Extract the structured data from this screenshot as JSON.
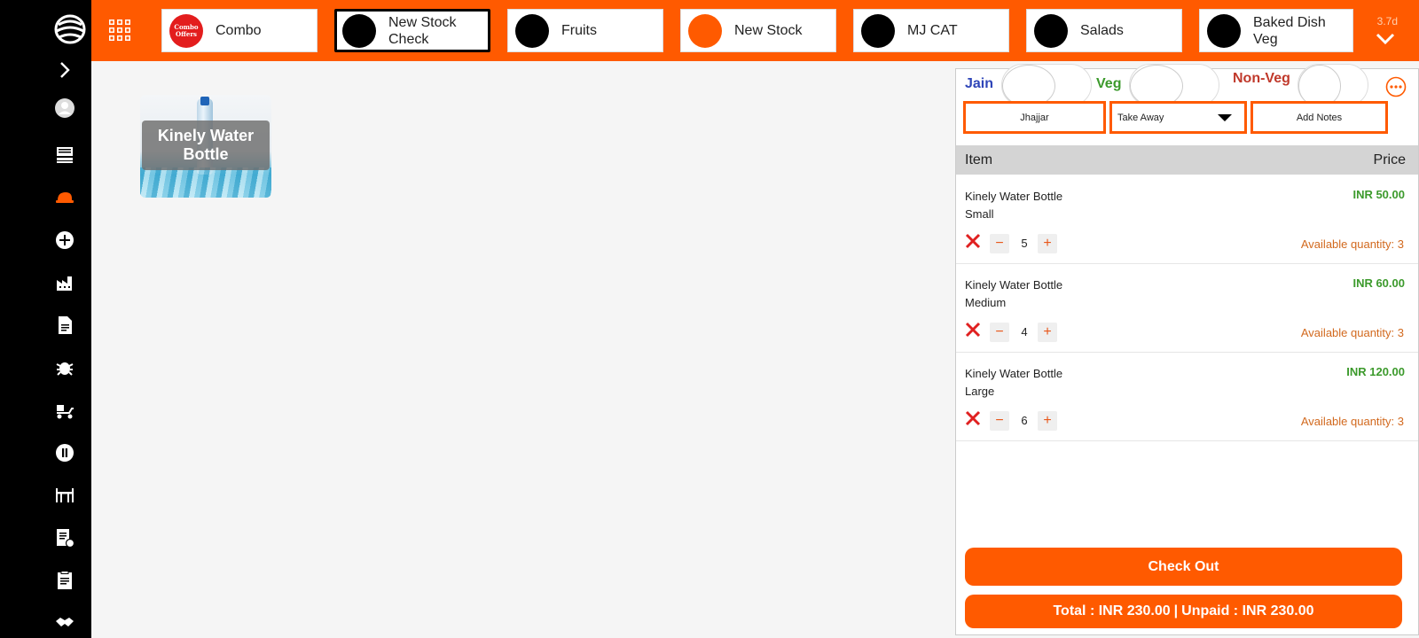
{
  "sidebar": {
    "items": [
      {
        "name": "expand-icon"
      },
      {
        "name": "profile-icon"
      },
      {
        "name": "pos-terminal-icon"
      },
      {
        "name": "delivery-hat-icon",
        "active_color": "#ff5a00"
      },
      {
        "name": "add-circle-icon"
      },
      {
        "name": "factory-icon"
      },
      {
        "name": "document-icon"
      },
      {
        "name": "bug-icon"
      },
      {
        "name": "delivery-scooter-icon"
      },
      {
        "name": "pause-icon"
      },
      {
        "name": "dining-table-icon"
      },
      {
        "name": "report-settings-icon"
      },
      {
        "name": "clipboard-icon"
      },
      {
        "name": "handshake-icon"
      }
    ]
  },
  "topbar": {
    "accent": "#ff5a00",
    "categories": [
      {
        "label": "Combo",
        "badge": "Combo Offers"
      },
      {
        "label": "New Stock Check"
      },
      {
        "label": "Fruits"
      },
      {
        "label": "New Stock"
      },
      {
        "label": "MJ CAT"
      },
      {
        "label": "Salads"
      },
      {
        "label": "Baked Dish Veg"
      }
    ],
    "size_label": "3.7d"
  },
  "products": [
    {
      "name": "Kinely Water Bottle",
      "bottle_brand": "kinley"
    }
  ],
  "order_panel": {
    "diet": {
      "jain": "Jain",
      "veg": "Veg",
      "nonveg": "Non-Veg"
    },
    "location": "Jhajjar",
    "mode": "Take Away",
    "notes_label": "Add Notes",
    "header": {
      "item": "Item",
      "price": "Price"
    },
    "items": [
      {
        "name": "Kinely Water Bottle",
        "variant": "Small",
        "price": "INR  50.00",
        "qty": "5",
        "available": "Available quantity: 3"
      },
      {
        "name": "Kinely Water Bottle",
        "variant": "Medium",
        "price": "INR  60.00",
        "qty": "4",
        "available": "Available quantity: 3"
      },
      {
        "name": "Kinely Water Bottle",
        "variant": "Large",
        "price": "INR  120.00",
        "qty": "6",
        "available": "Available quantity: 3"
      }
    ],
    "minus_symbol": "−",
    "plus_symbol": "+",
    "checkout_label": "Check Out",
    "total_label": "Total : INR  230.00",
    "unpaid_label": "Unpaid : INR  230.00",
    "separator": "|"
  }
}
